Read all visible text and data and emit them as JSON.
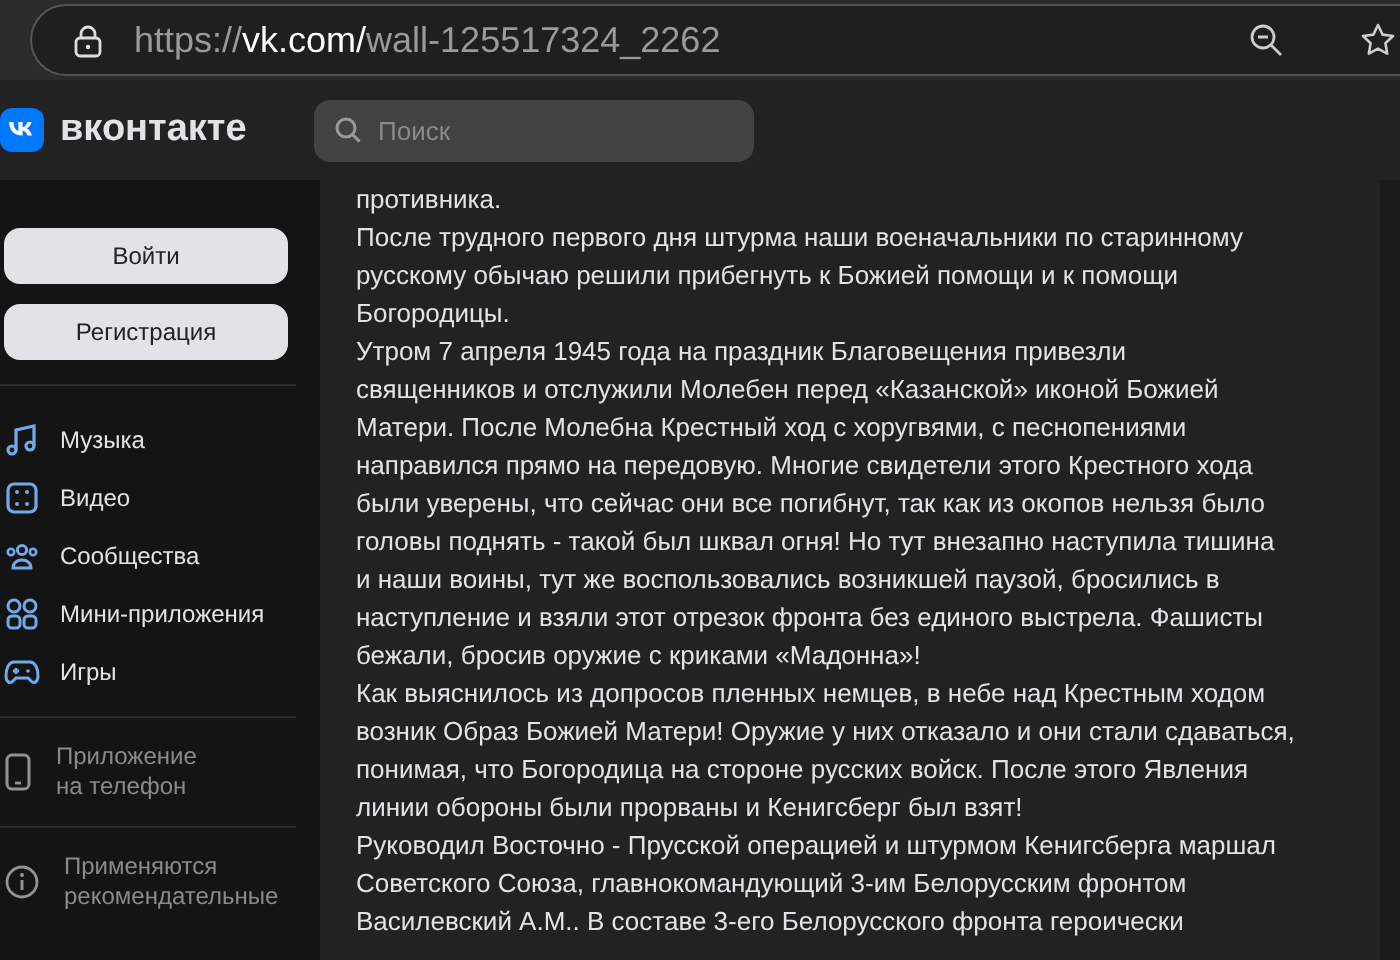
{
  "browser": {
    "url_host": "https://vk.com/",
    "url_path": "wall-125517324_2262"
  },
  "header": {
    "logo_text": "вконтакте",
    "search": {
      "placeholder": "Поиск"
    }
  },
  "sidebar": {
    "buttons": [
      "Войти",
      "Регистрация"
    ],
    "items": [
      {
        "kind": "music",
        "label": "Музыка"
      },
      {
        "kind": "video",
        "label": "Видео"
      },
      {
        "kind": "communities",
        "label": "Сообщества"
      },
      {
        "kind": "apps",
        "label": "Мини-приложения"
      },
      {
        "kind": "games",
        "label": "Игры"
      }
    ],
    "app_link": {
      "lines": [
        "Приложение",
        "на телефон"
      ]
    },
    "notice": {
      "lines": [
        "Применяются",
        "рекомендательные"
      ]
    }
  },
  "post": {
    "paragraphs": [
      {
        "lines": [
          "противника."
        ]
      },
      {
        "lines": [
          "После трудного первого дня штурма наши военачальники по старинному",
          "русскому обычаю решили прибегнуть к Божией помощи и к помощи",
          "Богородицы."
        ]
      },
      {
        "lines": [
          "Утром 7 апреля 1945 года на праздник Благовещения привезли",
          "священников и отслужили Молебен перед «Казанской» иконой Божией",
          "Матери. После Молебна Крестный ход с хоругвями, с песнопениями",
          "направился прямо на передовую. Многие свидетели этого Крестного хода",
          "были уверены, что сейчас они все погибнут, так как из окопов нельзя было",
          "головы поднять - такой был шквал огня! Но тут внезапно наступила тишина",
          "и наши воины, тут же воспользовались возникшей паузой, бросились в",
          "наступление и взяли этот отрезок фронта без единого выстрела. Фашисты",
          "бежали, бросив оружие с криками «Мадонна»!"
        ]
      },
      {
        "lines": [
          "Как выяснилось из допросов пленных немцев, в небе над Крестным ходом",
          "возник Образ Божией Матери! Оружие у них отказало и они стали сдаваться,",
          "понимая, что Богородица на стороне русских войск. После этого Явления",
          "линии обороны были прорваны и Кенигсберг был взят!"
        ]
      },
      {
        "lines": [
          "Руководил Восточно - Прусской операцией и штурмом Кенигсберга маршал",
          "Советского Союза, главнокомандующий 3-им Белорусским фронтом",
          "Василевский А.М.. В составе 3-его Белорусского фронта героически"
        ]
      }
    ]
  }
}
